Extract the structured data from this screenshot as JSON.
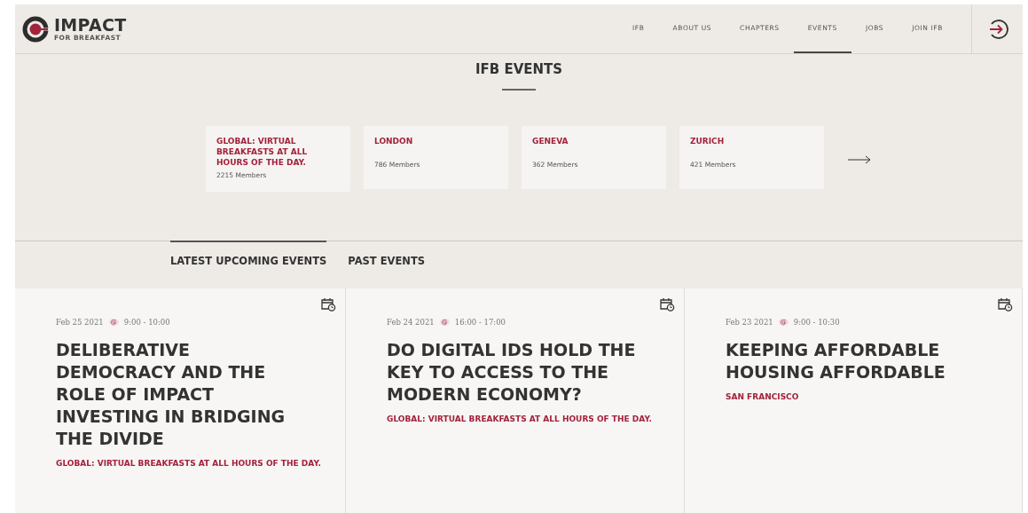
{
  "brand": {
    "name": "IMPACT",
    "tagline": "FOR BREAKFAST"
  },
  "nav": [
    {
      "label": "IFB",
      "selected": false
    },
    {
      "label": "ABOUT US",
      "selected": false
    },
    {
      "label": "CHAPTERS",
      "selected": false
    },
    {
      "label": "EVENTS",
      "selected": true
    },
    {
      "label": "JOBS",
      "selected": false
    },
    {
      "label": "JOIN IFB",
      "selected": false
    }
  ],
  "page_title": "IFB EVENTS",
  "chapters": [
    {
      "name": "GLOBAL: VIRTUAL BREAKFASTS AT ALL HOURS OF THE DAY.",
      "members": "2215 Members"
    },
    {
      "name": "LONDON",
      "members": "786 Members"
    },
    {
      "name": "GENEVA",
      "members": "362 Members"
    },
    {
      "name": "ZURICH",
      "members": "421 Members"
    }
  ],
  "tabs": [
    {
      "label": "LATEST UPCOMING EVENTS",
      "selected": true
    },
    {
      "label": "PAST EVENTS",
      "selected": false
    }
  ],
  "events": [
    {
      "date": "Feb 25 2021",
      "at": "@",
      "time": "9:00 - 10:00",
      "title": "DELIBERATIVE DEMOCRACY AND THE ROLE OF IMPACT INVESTING IN BRIDGING THE DIVIDE",
      "chapter": "GLOBAL: VIRTUAL BREAKFASTS AT ALL HOURS OF THE DAY."
    },
    {
      "date": "Feb 24 2021",
      "at": "@",
      "time": "16:00 - 17:00",
      "title": "DO DIGITAL IDS HOLD THE KEY TO ACCESS TO THE MODERN ECONOMY?",
      "chapter": "GLOBAL: VIRTUAL BREAKFASTS AT ALL HOURS OF THE DAY."
    },
    {
      "date": "Feb 23 2021",
      "at": "@",
      "time": "9:00 - 10:30",
      "title": "KEEPING AFFORDABLE HOUSING AFFORDABLE",
      "chapter": "SAN FRANCISCO"
    }
  ]
}
